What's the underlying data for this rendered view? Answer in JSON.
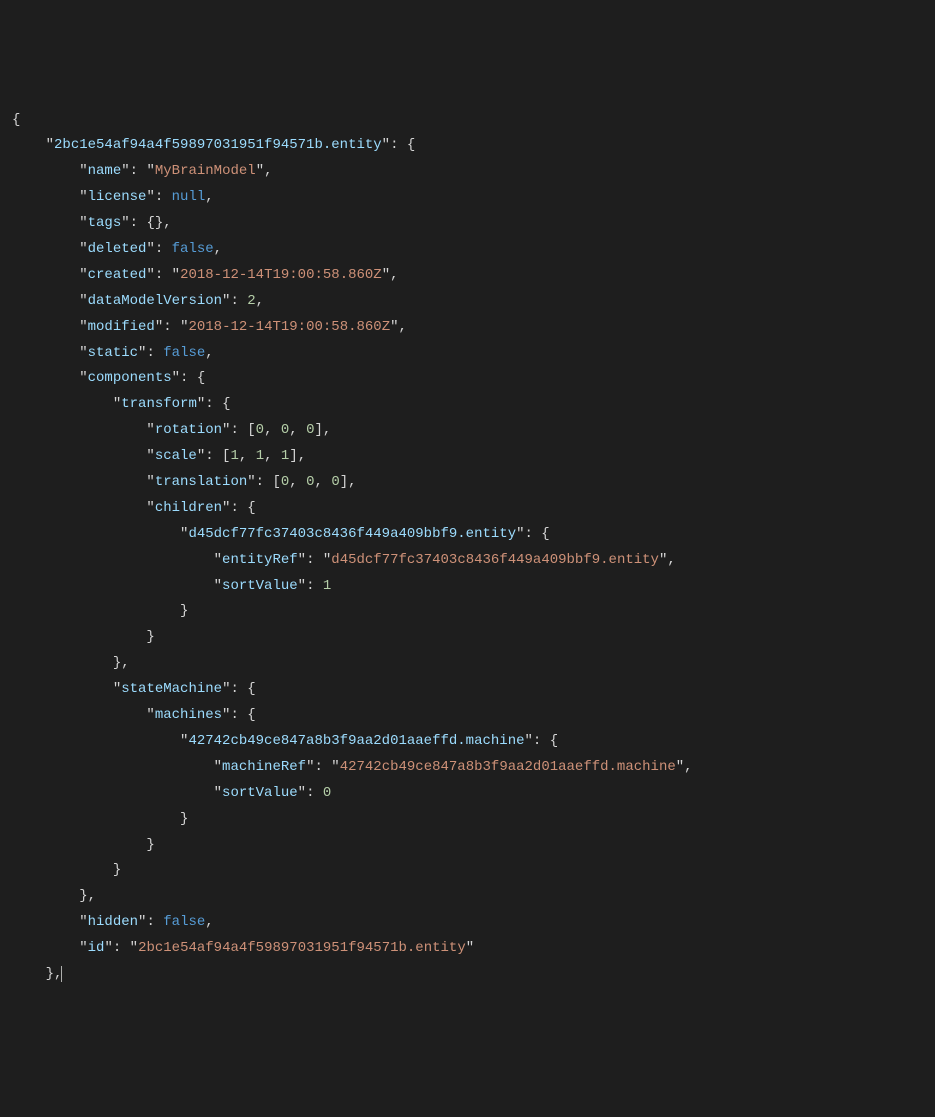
{
  "code": {
    "entityKey": "2bc1e54af94a4f59897031951f94571b.entity",
    "fields": {
      "name": {
        "key": "name",
        "value": "MyBrainModel"
      },
      "license": {
        "key": "license",
        "value": "null"
      },
      "tags": {
        "key": "tags"
      },
      "deleted": {
        "key": "deleted",
        "value": "false"
      },
      "created": {
        "key": "created",
        "value": "2018-12-14T19:00:58.860Z"
      },
      "dataModelVersion": {
        "key": "dataModelVersion",
        "value": "2"
      },
      "modified": {
        "key": "modified",
        "value": "2018-12-14T19:00:58.860Z"
      },
      "static": {
        "key": "static",
        "value": "false"
      },
      "components": {
        "key": "components"
      },
      "transform": {
        "key": "transform"
      },
      "rotation": {
        "key": "rotation",
        "v0": "0",
        "v1": "0",
        "v2": "0"
      },
      "scale": {
        "key": "scale",
        "v0": "1",
        "v1": "1",
        "v2": "1"
      },
      "translation": {
        "key": "translation",
        "v0": "0",
        "v1": "0",
        "v2": "0"
      },
      "children": {
        "key": "children"
      },
      "childEntityKey": "d45dcf77fc37403c8436f449a409bbf9.entity",
      "entityRef": {
        "key": "entityRef",
        "value": "d45dcf77fc37403c8436f449a409bbf9.entity"
      },
      "sortValue1": {
        "key": "sortValue",
        "value": "1"
      },
      "stateMachine": {
        "key": "stateMachine"
      },
      "machines": {
        "key": "machines"
      },
      "machineKey": "42742cb49ce847a8b3f9aa2d01aaeffd.machine",
      "machineRef": {
        "key": "machineRef",
        "value": "42742cb49ce847a8b3f9aa2d01aaeffd.machine"
      },
      "sortValue0": {
        "key": "sortValue",
        "value": "0"
      },
      "hidden": {
        "key": "hidden",
        "value": "false"
      },
      "id": {
        "key": "id",
        "value": "2bc1e54af94a4f59897031951f94571b.entity"
      }
    }
  }
}
